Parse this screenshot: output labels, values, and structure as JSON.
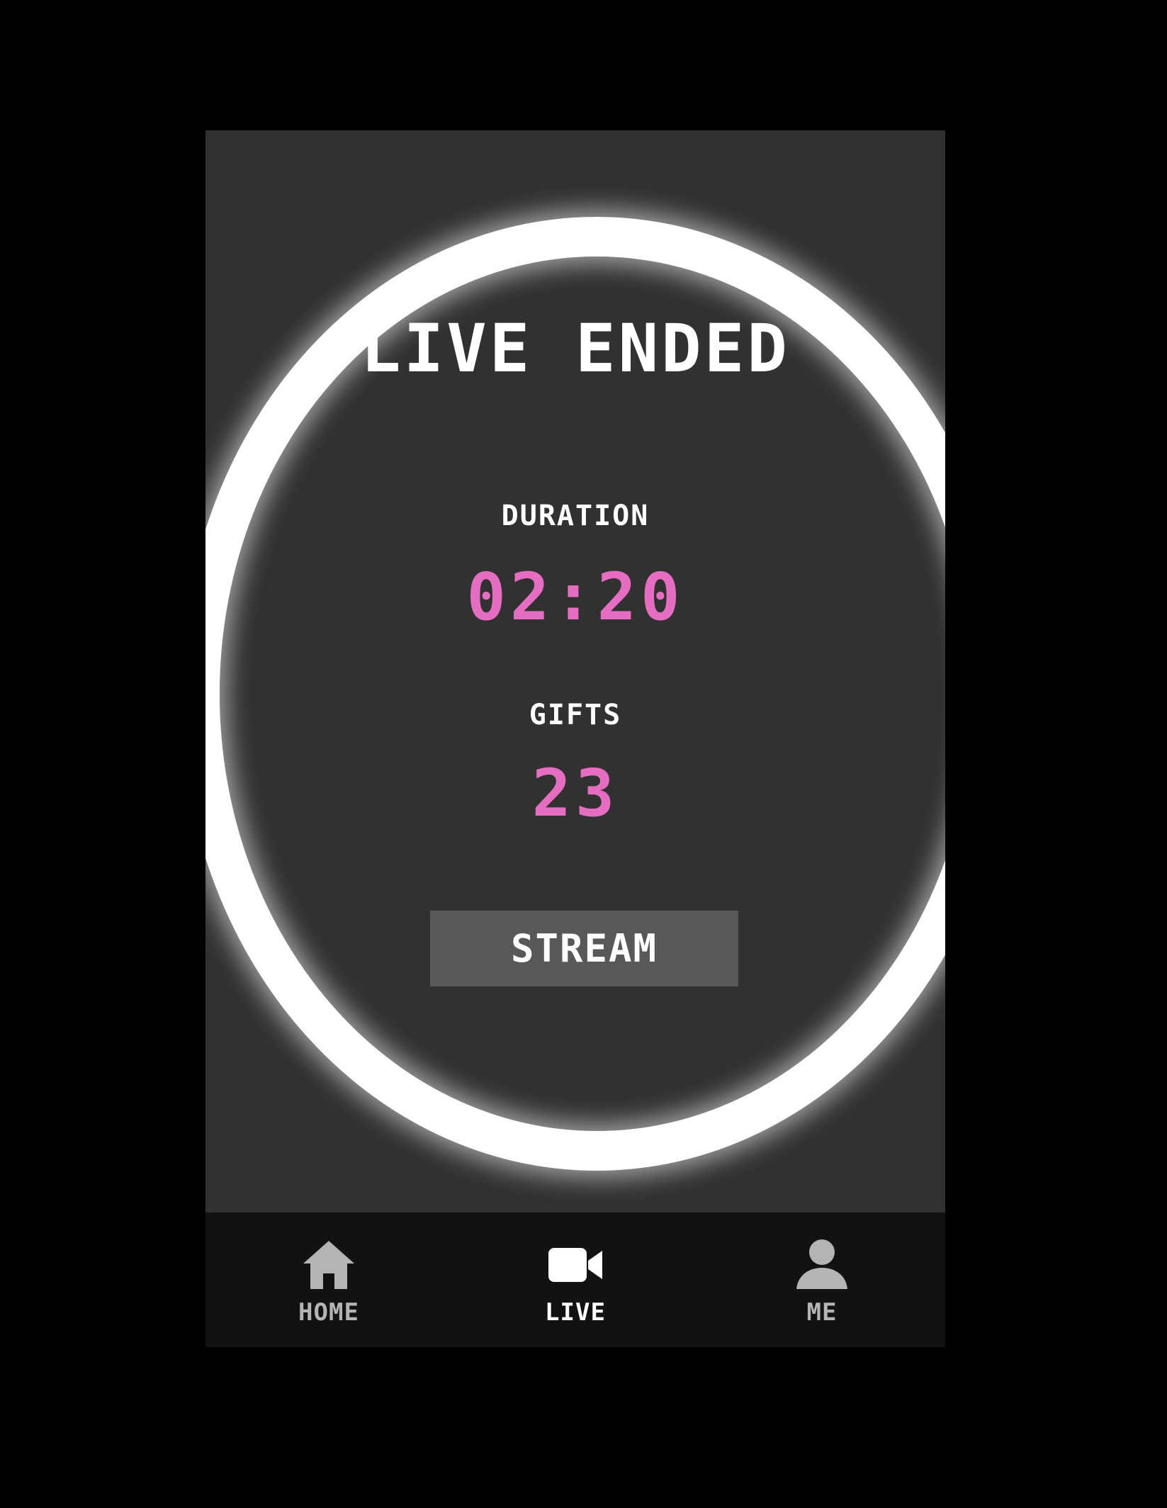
{
  "screen": {
    "title": "LIVE ENDED"
  },
  "stats": {
    "duration_label": "DURATION",
    "duration_value": "02:20",
    "gifts_label": "GIFTS",
    "gifts_value": "23"
  },
  "actions": {
    "stream_label": "STREAM"
  },
  "tabbar": {
    "items": [
      {
        "label": "HOME",
        "icon": "home-icon",
        "active": false
      },
      {
        "label": "LIVE",
        "icon": "video-camera-icon",
        "active": true
      },
      {
        "label": "ME",
        "icon": "person-icon",
        "active": false
      }
    ]
  },
  "colors": {
    "background": "#000000",
    "panel": "#313131",
    "accent_pink": "#e66ec2",
    "text_white": "#ffffff",
    "button_bg": "#585858",
    "tabbar_bg": "#121212",
    "tab_inactive": "#b4b4b4",
    "tab_active": "#ffffff"
  }
}
